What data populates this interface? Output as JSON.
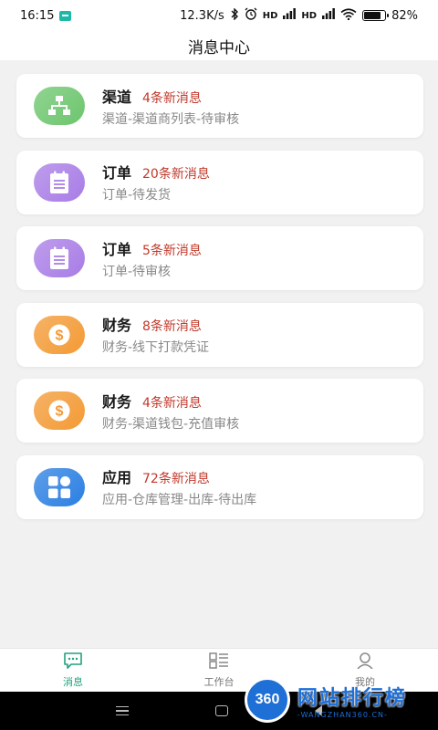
{
  "status_bar": {
    "time": "16:15",
    "net_speed": "12.3K/s",
    "signal1": "HD",
    "signal2": "HD",
    "battery": "82%",
    "battery_level": 0.82
  },
  "header": {
    "title": "消息中心"
  },
  "messages": [
    {
      "title": "渠道",
      "count": "4条新消息",
      "subtitle": "渠道-渠道商列表-待审核",
      "icon": "org-chart-icon",
      "color": "#6cc56d"
    },
    {
      "title": "订单",
      "count": "20条新消息",
      "subtitle": "订单-待发货",
      "icon": "notepad-icon",
      "color": "#a87ce6"
    },
    {
      "title": "订单",
      "count": "5条新消息",
      "subtitle": "订单-待审核",
      "icon": "notepad-icon",
      "color": "#a87ce6"
    },
    {
      "title": "财务",
      "count": "8条新消息",
      "subtitle": "财务-线下打款凭证",
      "icon": "dollar-coin-icon",
      "color": "#f39a34"
    },
    {
      "title": "财务",
      "count": "4条新消息",
      "subtitle": "财务-渠道钱包-充值审核",
      "icon": "dollar-coin-icon",
      "color": "#f39a34"
    },
    {
      "title": "应用",
      "count": "72条新消息",
      "subtitle": "应用-仓库管理-出库-待出库",
      "icon": "apps-grid-icon",
      "color": "#2a7fe2"
    }
  ],
  "tabs": [
    {
      "label": "消息",
      "icon": "chat-icon",
      "active": true
    },
    {
      "label": "工作台",
      "icon": "workbench-icon",
      "active": false
    },
    {
      "label": "我的",
      "icon": "person-icon",
      "active": false
    }
  ],
  "watermark": {
    "badge": "360",
    "title": "网站排行榜",
    "url": "-WANGZHAN360.CN-"
  },
  "colors": {
    "accent": "#22a17f",
    "count_red": "#c0392b"
  }
}
